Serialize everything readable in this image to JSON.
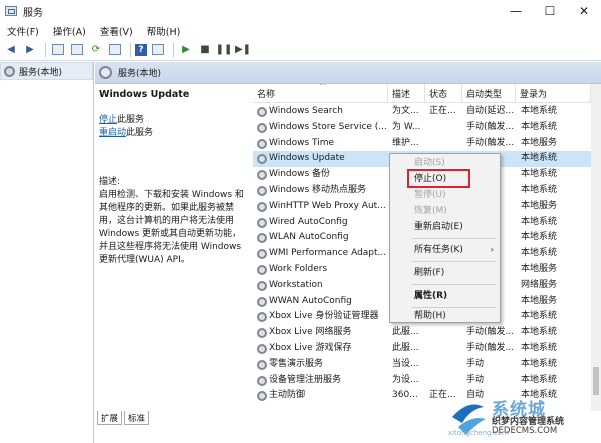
{
  "window": {
    "title": "服务",
    "controls": [
      "—",
      "☐",
      "✕"
    ]
  },
  "menu": [
    "文件(F)",
    "操作(A)",
    "查看(V)",
    "帮助(H)"
  ],
  "tree": {
    "item": "服务(本地)"
  },
  "header": {
    "title": "服务(本地)"
  },
  "desc": {
    "title": "Windows Update",
    "stop_link": "停止",
    "stop_suffix": "此服务",
    "restart_link": "重启动",
    "restart_suffix": "此服务",
    "label": "描述:",
    "lines": [
      "启用检测、下载和安装 Windows 和",
      "其他程序的更新。如果此服务被禁",
      "用，这台计算机的用户将无法使用",
      "Windows 更新或其自动更新功能，",
      "并且这些程序将无法使用 Windows",
      "更新代理(WUA) API。"
    ]
  },
  "tabs": [
    "扩展",
    "标准"
  ],
  "table": {
    "columns": [
      "名称",
      "描述",
      "状态",
      "启动类型",
      "登录为"
    ],
    "rows": [
      {
        "name": "Windows Search",
        "desc": "为文...",
        "status": "正在...",
        "startup": "自动(延迟...",
        "logon": "本地系统"
      },
      {
        "name": "Windows Store Service (...",
        "desc": "为 W...",
        "status": "",
        "startup": "手动(触发...",
        "logon": "本地系统"
      },
      {
        "name": "Windows Time",
        "desc": "维护...",
        "status": "",
        "startup": "手动(触发...",
        "logon": "本地服务"
      },
      {
        "name": "Windows Update",
        "desc": "",
        "status": "",
        "startup": "",
        "logon": "本地系统"
      },
      {
        "name": "Windows 备份",
        "desc": "",
        "status": "",
        "startup": "",
        "logon": "本地系统"
      },
      {
        "name": "Windows 移动热点服务",
        "desc": "",
        "status": "",
        "startup": "",
        "logon": "本地系统"
      },
      {
        "name": "WinHTTP Web Proxy Aut...",
        "desc": "",
        "status": "",
        "startup": "",
        "logon": "本地服务"
      },
      {
        "name": "Wired AutoConfig",
        "desc": "",
        "status": "",
        "startup": "",
        "logon": "本地系统"
      },
      {
        "name": "WLAN AutoConfig",
        "desc": "",
        "status": "",
        "startup": "",
        "logon": "本地系统"
      },
      {
        "name": "WMI Performance Adapt...",
        "desc": "",
        "status": "",
        "startup": "",
        "logon": "本地系统"
      },
      {
        "name": "Work Folders",
        "desc": "",
        "status": "",
        "startup": "",
        "logon": "本地服务"
      },
      {
        "name": "Workstation",
        "desc": "",
        "status": "",
        "startup": "",
        "logon": "网络服务"
      },
      {
        "name": "WWAN AutoConfig",
        "desc": "",
        "status": "",
        "startup": "",
        "logon": "本地服务"
      },
      {
        "name": "Xbox Live 身份验证管理器",
        "desc": "",
        "status": "",
        "startup": "",
        "logon": "本地系统"
      },
      {
        "name": "Xbox Live 网络服务",
        "desc": "此服...",
        "status": "",
        "startup": "手动(触发...",
        "logon": "本地系统"
      },
      {
        "name": "Xbox Live 游戏保存",
        "desc": "此服...",
        "status": "",
        "startup": "手动(触发...",
        "logon": "本地系统"
      },
      {
        "name": "零售演示服务",
        "desc": "当设...",
        "status": "",
        "startup": "手动",
        "logon": "本地系统"
      },
      {
        "name": "设备管理注册服务",
        "desc": "为设...",
        "status": "",
        "startup": "手动",
        "logon": "本地系统"
      },
      {
        "name": "主动防御",
        "desc": "360...",
        "status": "正在...",
        "startup": "自动",
        "logon": "本地系统"
      }
    ]
  },
  "context_menu": {
    "items": [
      "启动(S)",
      "停止(O)",
      "暂停(U)",
      "恢复(M)",
      "重新启动(E)",
      "所有任务(K)",
      "刷新(F)",
      "属性(R)",
      "帮助(H)"
    ],
    "disabled": [
      "启动(S)",
      "暂停(U)",
      "恢复(M)"
    ],
    "highlighted": "停止(O)"
  },
  "watermark": {
    "cn": "系统城",
    "brand": "织梦内容管理系统",
    "url": "DEDECMS.COM",
    "sub": "xitongcheng.com"
  },
  "colors": {
    "accent": "#1a5fb4",
    "selected_row": "#cce4f7",
    "highlight_box": "#d9232d"
  }
}
